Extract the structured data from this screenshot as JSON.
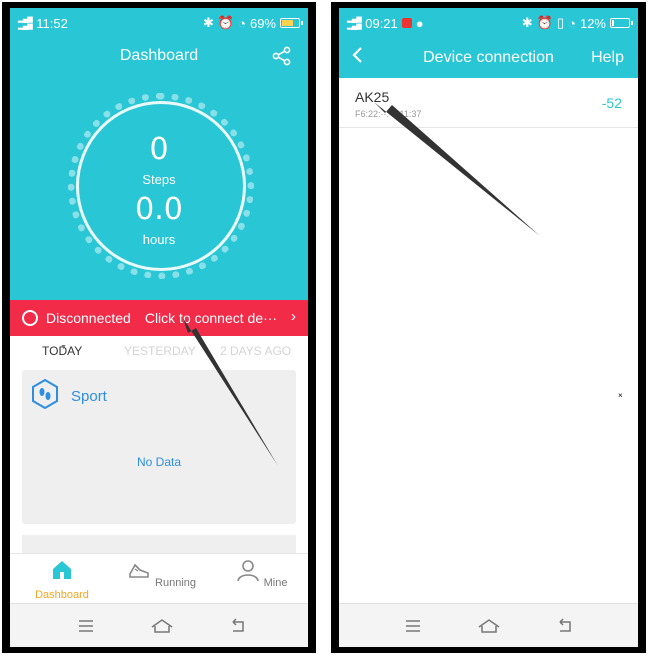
{
  "left_screen": {
    "status": {
      "signal_left": "2G 4G",
      "time": "11:52",
      "battery": "69%"
    },
    "title": "Dashboard",
    "steps_value": "0",
    "steps_label": "Steps",
    "hours_value": "0.0",
    "hours_label": "hours",
    "banner": {
      "status": "Disconnected",
      "action": "Click to connect de···"
    },
    "day_tabs": [
      "TODAY",
      "YESTERDAY",
      "2 DAYS AGO"
    ],
    "sport_card": {
      "title": "Sport",
      "empty_text": "No Data"
    },
    "nav": [
      "Dashboard",
      "Running",
      "Mine"
    ]
  },
  "right_screen": {
    "status": {
      "signal_left": "4G 4G",
      "time": "09:21",
      "battery": "12%"
    },
    "title": "Device connection",
    "help": "Help",
    "device": {
      "name": "AK25",
      "mac": "F6:22:··:·5:11:37",
      "rssi": "-52"
    }
  },
  "colors": {
    "teal": "#29c6d5",
    "red": "#f12b48",
    "blue": "#2e8ee0",
    "orange": "#f5a623"
  }
}
